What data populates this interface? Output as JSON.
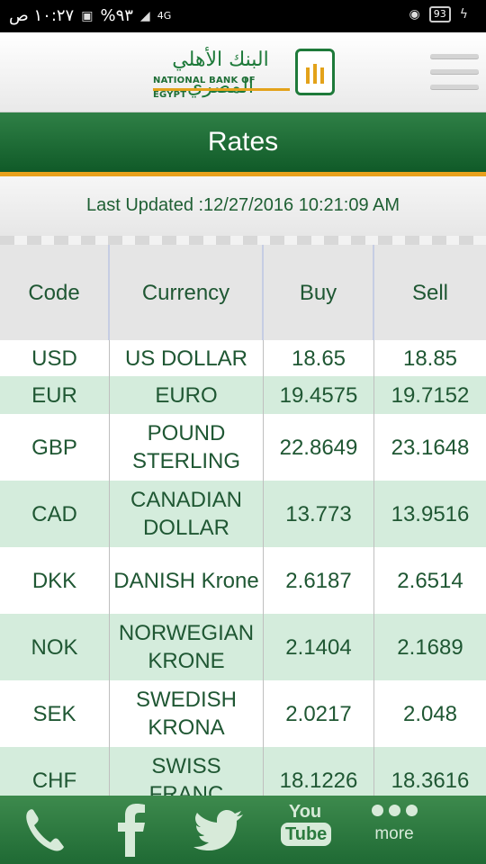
{
  "status_bar": {
    "time": "١٠:٢٧ ص",
    "battery_percent": "%٩٣",
    "network": "4G",
    "battery_icon_text": "93"
  },
  "header": {
    "logo_arabic": "البنك الأهلي المصري",
    "logo_english": "NATIONAL BANK OF EGYPT",
    "brand_green": "#1e7a3a",
    "brand_gold": "#e3a21a"
  },
  "title": "Rates",
  "last_updated": "Last Updated :12/27/2016 10:21:09 AM",
  "table": {
    "headers": [
      "Code",
      "Currency",
      "Buy",
      "Sell"
    ],
    "rows": [
      {
        "code": "USD",
        "currency": "US DOLLAR",
        "buy": "18.65",
        "sell": "18.85"
      },
      {
        "code": "EUR",
        "currency": "EURO",
        "buy": "19.4575",
        "sell": "19.7152"
      },
      {
        "code": "GBP",
        "currency": "POUND STERLING",
        "buy": "22.8649",
        "sell": "23.1648"
      },
      {
        "code": "CAD",
        "currency": "CANADIAN DOLLAR",
        "buy": "13.773",
        "sell": "13.9516"
      },
      {
        "code": "DKK",
        "currency": "DANISH Krone",
        "buy": "2.6187",
        "sell": "2.6514"
      },
      {
        "code": "NOK",
        "currency": "NORWEGIAN KRONE",
        "buy": "2.1404",
        "sell": "2.1689"
      },
      {
        "code": "SEK",
        "currency": "SWEDISH KRONA",
        "buy": "2.0217",
        "sell": "2.048"
      },
      {
        "code": "CHF",
        "currency": "SWISS FRANC",
        "buy": "18.1226",
        "sell": "18.3616"
      }
    ]
  },
  "footer": {
    "items": [
      {
        "icon": "phone-icon"
      },
      {
        "icon": "facebook-icon"
      },
      {
        "icon": "twitter-icon"
      },
      {
        "icon": "youtube-icon",
        "text_top": "You",
        "text_bottom": "Tube"
      },
      {
        "icon": "more-icon",
        "label": "more"
      }
    ]
  }
}
